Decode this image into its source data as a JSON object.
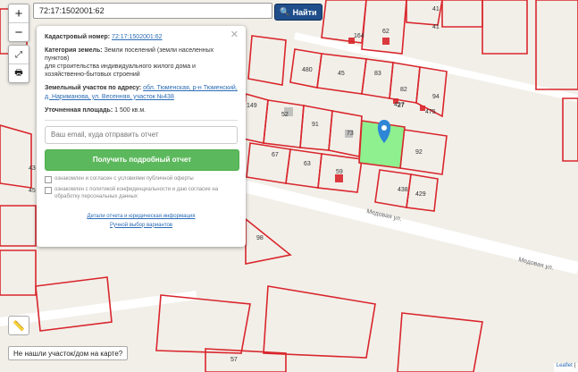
{
  "search": {
    "value": "72:17:1502001:62",
    "button_label": "Найти"
  },
  "controls": {
    "zoom_in": "+",
    "zoom_out": "−"
  },
  "panel": {
    "cadastral_label": "Кадастровый номер:",
    "cadastral_value": "72:17:1502001:62",
    "category_label": "Категория земель:",
    "category_value": "Земли поселений (земли населенных пунктов)",
    "category_purpose": "для строительства индивидуального жилого дома и хозяйственно-бытовых строений",
    "address_label": "Земельный участок по адресу:",
    "address_value": "обл. Тюменская, р-н Тюменский, д. Нариманова, ул. Весенняя, участок №438",
    "area_label": "Уточненная площадь:",
    "area_value": "1 500 кв.м.",
    "email_placeholder": "Ваш email, куда отправить отчет",
    "report_button": "Получить подробный отчет",
    "agree_offer": "ознакомлен и согласен с условиями публичной оферты",
    "agree_privacy": "ознакомлен с политикой конфиденциальности и даю согласие на обработку персональных данных",
    "link_details": "Детали отчета и юридическая информация",
    "link_manual": "Ручной выбор вариантов"
  },
  "map": {
    "parcel_labels": [
      "41",
      "41",
      "164",
      "62",
      "45",
      "83",
      "82",
      "94",
      "27",
      "475",
      "149",
      "52",
      "91",
      "73",
      "92",
      "67",
      "63",
      "59",
      "438",
      "429",
      "98",
      "43",
      "45",
      "57",
      "480",
      "427"
    ],
    "street_1": "Медовая ул.",
    "street_2": "Медовая ул.",
    "highlight_color": "#8ef08e",
    "line_color": "#d9262c"
  },
  "not_found": "Не нашли участок/дом на карте?",
  "attribution": {
    "leaflet": "Leaflet",
    "separator": "|"
  }
}
